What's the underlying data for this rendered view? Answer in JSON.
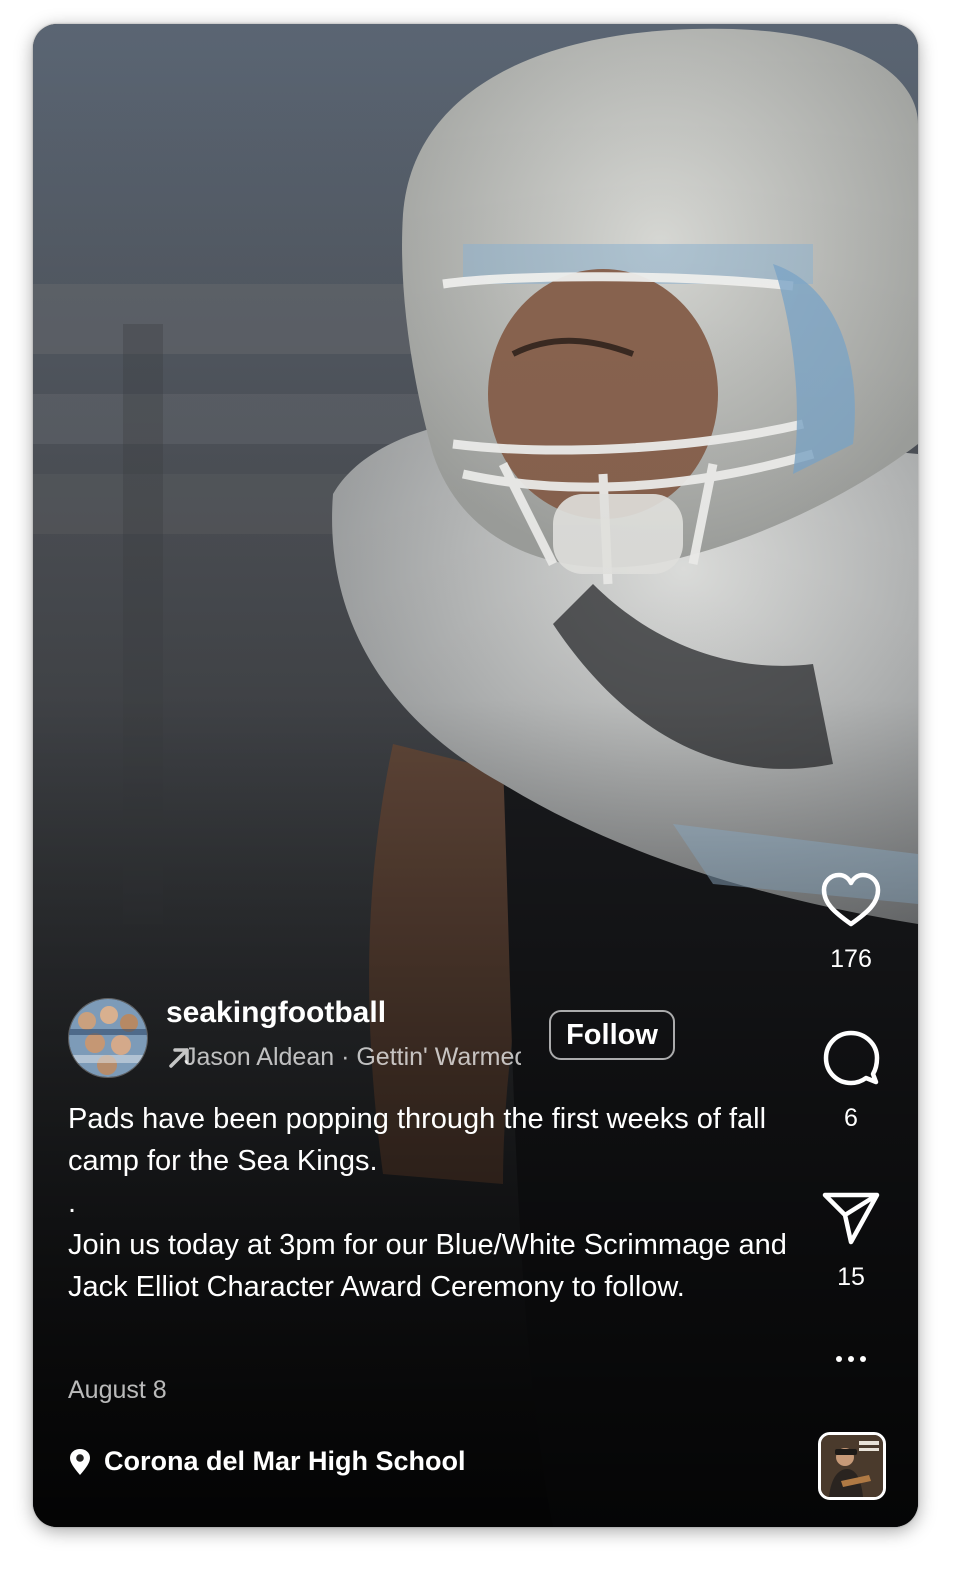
{
  "post": {
    "username": "seakingfootball",
    "audio_label": "Jason Aldean · Gettin' Warmed Up",
    "follow_label": "Follow",
    "caption_lines": [
      "Pads have been popping through the first weeks of fall camp for the Sea Kings.",
      ".",
      "Join us today at 3pm for our Blue/White Scrimmage and Jack Elliot Character Award Ceremony to follow."
    ],
    "date": "August 8",
    "location": "Corona del Mar High School"
  },
  "actions": {
    "likes": "176",
    "comments": "6",
    "shares": "15"
  },
  "icons": {
    "like": "heart-icon",
    "comment": "comment-bubble-icon",
    "share": "paper-plane-icon",
    "more": "more-dots-icon",
    "audio": "arrow-up-right-icon",
    "location": "location-pin-icon"
  },
  "colors": {
    "text": "#ffffff",
    "muted_text": "rgba(255,255,255,0.72)"
  }
}
